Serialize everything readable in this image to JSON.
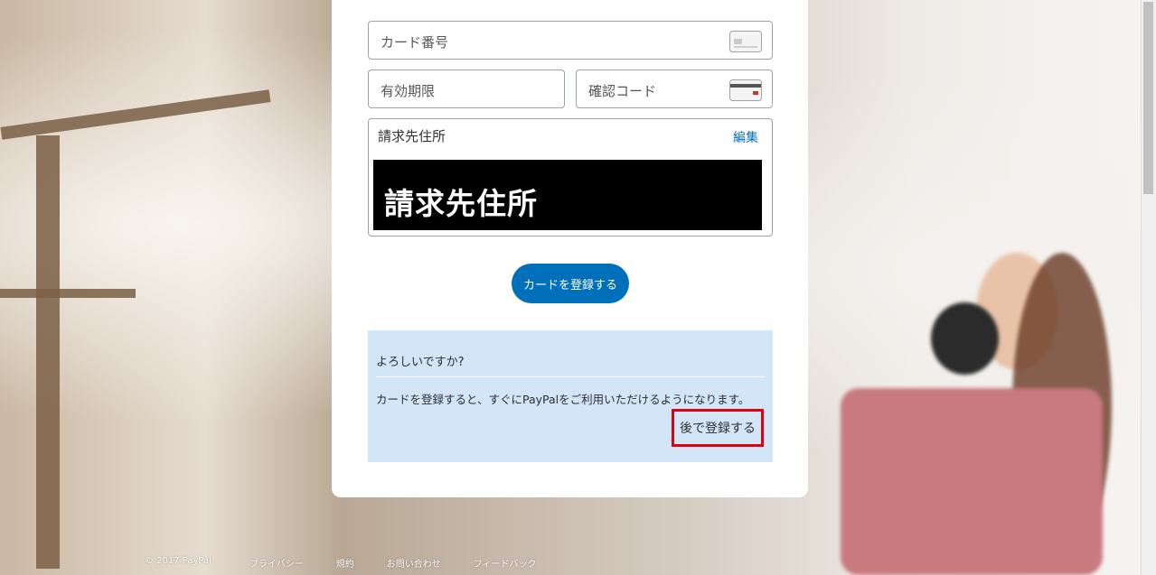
{
  "form": {
    "card_number_placeholder": "カード番号",
    "expiry_placeholder": "有効期限",
    "cvv_placeholder": "確認コード",
    "billing_address_label": "請求先住所",
    "edit_link": "編集",
    "billing_address_value": "請求先住所",
    "submit_label": "カードを登録する"
  },
  "notice": {
    "question": "よろしいですか?",
    "message": "カードを登録すると、すぐにPayPalをご利用いただけるようになります。",
    "later_label": "後で登録する",
    "highlight_color": "#e0000f"
  },
  "footer": {
    "copyright": "© 2017 PayPal",
    "links": [
      "プライバシー",
      "規約",
      "お問い合わせ",
      "フィードバック"
    ]
  },
  "colors": {
    "accent": "#0070ba",
    "notice_bg": "#d2e6f8"
  },
  "icons": {
    "card": "credit-card-front-icon",
    "cvv": "credit-card-back-icon"
  }
}
